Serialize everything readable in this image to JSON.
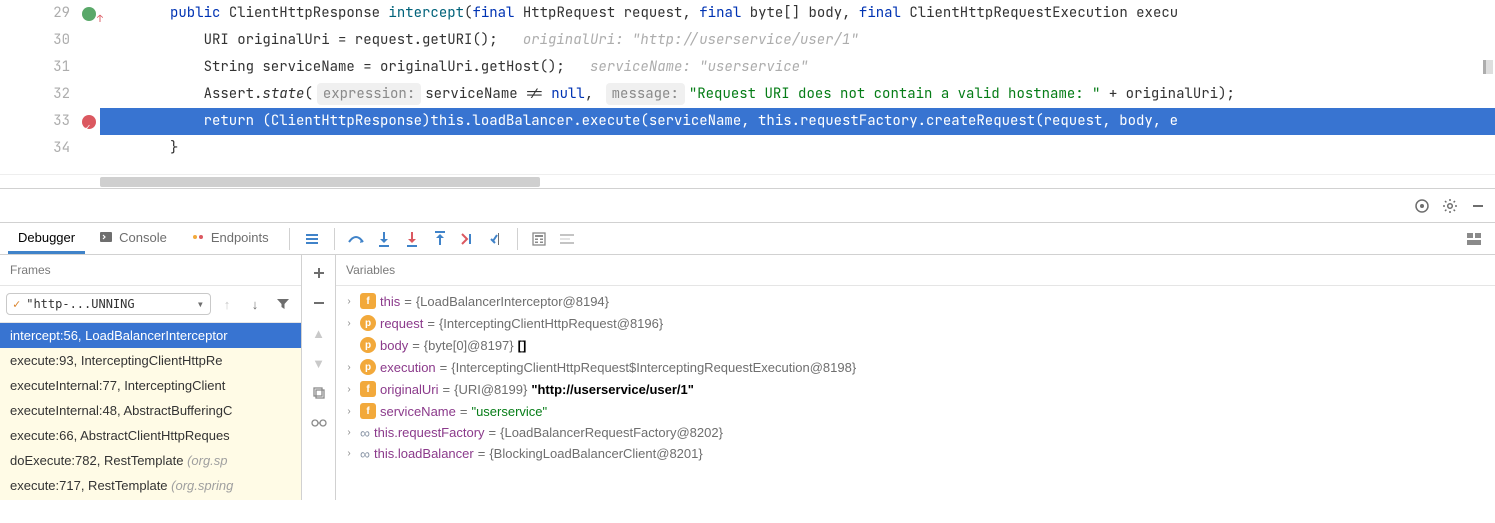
{
  "editor": {
    "lines": [
      {
        "num": "29",
        "gutterIcon": "green"
      },
      {
        "num": "30"
      },
      {
        "num": "31"
      },
      {
        "num": "32"
      },
      {
        "num": "33",
        "gutterIcon": "bp",
        "highlight": true
      },
      {
        "num": "34"
      },
      {
        "num": ""
      }
    ],
    "code29": {
      "kw1": "public",
      "type": "ClientHttpResponse",
      "name": "intercept",
      "kw2": "final",
      "t2": "HttpRequest",
      "p1": "request",
      "kw3": "final",
      "t3": "byte",
      "p2": "body",
      "kw4": "final",
      "t4": "ClientHttpRequestExecution",
      "p3": "execu"
    },
    "code30": {
      "text": "URI originalUri = request.getURI();",
      "hint": "originalUri: \"http://userservice/user/1\""
    },
    "code31": {
      "text": "String serviceName = originalUri.getHost();",
      "hint": "serviceName: \"userservice\""
    },
    "code32": {
      "a": "Assert.",
      "m": "state",
      "pill1": "expression:",
      "b": "serviceName != ",
      "kw": "null",
      "c": ",",
      "pill2": "message:",
      "str": "\"Request URI does not contain a valid hostname: \"",
      "d": " + originalUri);"
    },
    "code33": {
      "kw": "return",
      "text": " (ClientHttpResponse)this.loadBalancer.execute(serviceName, this.requestFactory.createRequest(request, body, e"
    },
    "code34": {
      "text": "}"
    }
  },
  "debugTabs": {
    "debugger": "Debugger",
    "console": "Console",
    "endpoints": "Endpoints"
  },
  "framesHeader": "Frames",
  "variablesHeader": "Variables",
  "threadSelect": "\"http-...UNNING",
  "frames": [
    {
      "text": "intercept:56, LoadBalancerInterceptor",
      "selected": true
    },
    {
      "text": "execute:93, InterceptingClientHttpRe"
    },
    {
      "text": "executeInternal:77, InterceptingClient"
    },
    {
      "text": "executeInternal:48, AbstractBufferingC"
    },
    {
      "text": "execute:66, AbstractClientHttpReques"
    },
    {
      "text": "doExecute:782, RestTemplate",
      "dim": "(org.sp"
    },
    {
      "text": "execute:717, RestTemplate",
      "dim": "(org.spring"
    }
  ],
  "variables": [
    {
      "badge": "f",
      "name": "this",
      "eq": " = ",
      "val": "{LoadBalancerInterceptor@8194}"
    },
    {
      "badge": "p",
      "name": "request",
      "eq": " = ",
      "val": "{InterceptingClientHttpRequest@8196}"
    },
    {
      "badge": "p",
      "name": "body",
      "eq": " = ",
      "val": "{byte[0]@8197} ",
      "extra": "[]",
      "noExpand": true
    },
    {
      "badge": "p",
      "name": "execution",
      "eq": " = ",
      "val": "{InterceptingClientHttpRequest$InterceptingRequestExecution@8198}"
    },
    {
      "badge": "f",
      "name": "originalUri",
      "eq": " = ",
      "val": "{URI@8199} ",
      "str": "\"http://userservice/user/1\""
    },
    {
      "badge": "f",
      "name": "serviceName",
      "eq": " = ",
      "strOnly": "\"userservice\""
    },
    {
      "badge": "link",
      "name": "this.requestFactory",
      "eq": " = ",
      "val": "{LoadBalancerRequestFactory@8202}"
    },
    {
      "badge": "link",
      "name": "this.loadBalancer",
      "eq": " = ",
      "val": "{BlockingLoadBalancerClient@8201}"
    }
  ]
}
